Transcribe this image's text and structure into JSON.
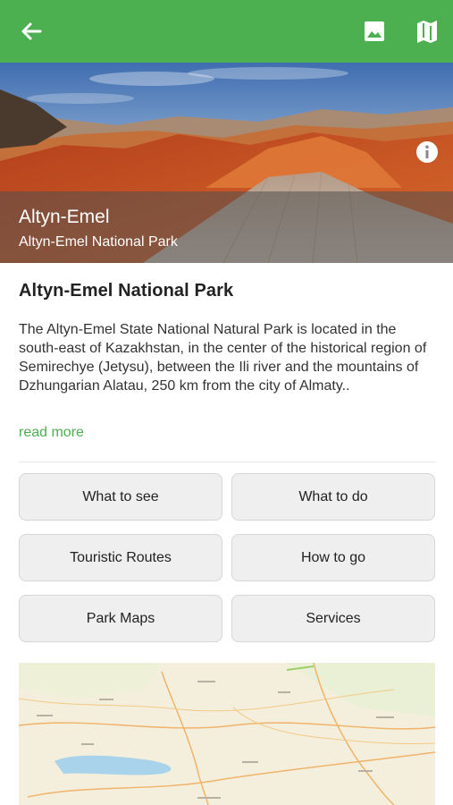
{
  "appbar": {
    "back_icon": "arrow-back-icon",
    "gallery_icon": "image-gallery-icon",
    "map_icon": "map-icon",
    "color": "#4caf50"
  },
  "hero": {
    "title": "Altyn-Emel",
    "subtitle": "Altyn-Emel National Park",
    "info_icon": "info-icon"
  },
  "content": {
    "heading": "Altyn-Emel National Park",
    "description": "The Altyn-Emel State National Natural Park is located in the south-east of Kazakhstan, in the center of the historical region of Semirechye (Jetysu), between the Ili river and the mountains of Dzhungarian Alatau, 250 km from the city of Almaty..",
    "read_more": "read more",
    "accent": "#4caf50"
  },
  "buttons": {
    "what_to_see": "What to see",
    "what_to_do": "What to do",
    "touristic_routes": "Touristic Routes",
    "how_to_go": "How to go",
    "park_maps": "Park Maps",
    "services": "Services"
  }
}
